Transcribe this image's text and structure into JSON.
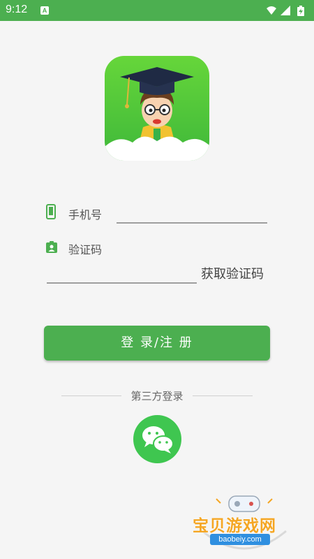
{
  "status_bar": {
    "time": "9:12",
    "notification_badge": "A",
    "icons": [
      "wifi-icon",
      "signal-icon",
      "battery-icon"
    ]
  },
  "logo": {
    "icon": "graduate-boy-icon"
  },
  "form": {
    "phone_label": "手机号",
    "code_label": "验证码",
    "get_code_label": "获取验证码"
  },
  "login_button_label": "登 录/注 册",
  "third_party": {
    "label": "第三方登录",
    "icon": "wechat-icon"
  },
  "watermark": {
    "text": "宝贝游戏网",
    "url": "baobeiy.com"
  },
  "colors": {
    "accent": "#4caf50",
    "wechat": "#3fc650",
    "background": "#f5f5f5"
  }
}
